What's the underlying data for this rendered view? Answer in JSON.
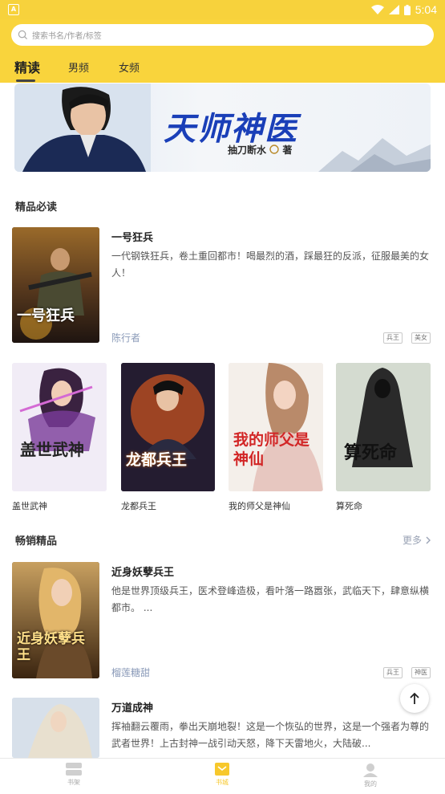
{
  "status": {
    "app_badge": "A",
    "time": "5:04"
  },
  "search": {
    "placeholder": "搜索书名/作者/标签"
  },
  "tabs": [
    {
      "label": "精读"
    },
    {
      "label": "男频"
    },
    {
      "label": "女频"
    }
  ],
  "banner": {
    "title": "天师神医",
    "author": "抽刀断水",
    "author_suffix": "著"
  },
  "sections": {
    "recommended": {
      "title": "精品必读",
      "featured": {
        "title": "一号狂兵",
        "description": "一代钢铁狂兵，卷土重回都市！喝最烈的酒，踩最狂的反派，征服最美的女人！",
        "author": "陈行者",
        "tags": [
          "兵王",
          "美女"
        ],
        "cover_text": "一号狂兵"
      },
      "grid": [
        {
          "title": "盖世武神",
          "cover_text": "盖世武神"
        },
        {
          "title": "龙都兵王",
          "cover_text": "龙都兵王"
        },
        {
          "title": "我的师父是神仙",
          "cover_text": "我的师父是神仙"
        },
        {
          "title": "算死命",
          "cover_text": "算死命"
        }
      ]
    },
    "bestsellers": {
      "title": "畅销精品",
      "more": "更多",
      "books": [
        {
          "title": "近身妖孽兵王",
          "description": "他是世界顶级兵王，医术登峰造极，看叶落一路嚣张，武临天下，肆意纵横都市。 ...",
          "author": "榴莲糖甜",
          "tags": [
            "兵王",
            "神医"
          ],
          "cover_text": "近身妖孽兵王"
        },
        {
          "title": "万道成神",
          "description": "挥袖翻云覆雨，拳出天崩地裂！这是一个恢弘的世界，这是一个强者为尊的武者世界！上古封神一战引动天怒，降下天雷地火，大陆破...",
          "cover_text": ""
        }
      ]
    }
  },
  "bottom_nav": [
    {
      "label": "书架",
      "icon": "bookshelf-icon"
    },
    {
      "label": "书城",
      "icon": "bookstore-icon"
    },
    {
      "label": "我的",
      "icon": "profile-icon"
    }
  ],
  "colors": {
    "accent": "#f9d43c",
    "banner_title": "#1a3fb8",
    "author": "#8a9ab8"
  }
}
